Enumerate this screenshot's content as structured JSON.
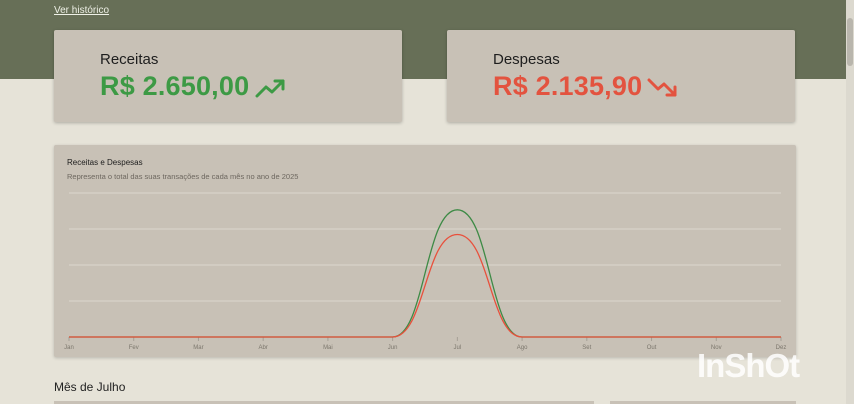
{
  "header": {
    "history_link": "Ver histórico"
  },
  "summary": {
    "income": {
      "label": "Receitas",
      "amount": "R$ 2.650,00",
      "icon": "trending-up-icon",
      "color": "#3d9a45"
    },
    "expenses": {
      "label": "Despesas",
      "amount": "R$ 2.135,90",
      "icon": "trending-down-icon",
      "color": "#e3533f"
    }
  },
  "chart": {
    "title": "Receitas e Despesas",
    "subtitle": "Representa o total das suas transações de cada mês no ano de 2025"
  },
  "chart_data": {
    "type": "line",
    "title": "Receitas e Despesas",
    "subtitle": "Representa o total das suas transações de cada mês no ano de 2025",
    "x": [
      "Jan",
      "Fev",
      "Mar",
      "Abr",
      "Mai",
      "Jun",
      "Jul",
      "Ago",
      "Set",
      "Out",
      "Nov",
      "Dez"
    ],
    "series": [
      {
        "color": "#3d8a45",
        "values": [
          0,
          0,
          0,
          0,
          0,
          0,
          2650,
          0,
          0,
          0,
          0,
          0
        ]
      },
      {
        "color": "#e8503c",
        "values": [
          0,
          0,
          0,
          0,
          0,
          0,
          2135.9,
          0,
          0,
          0,
          0,
          0
        ]
      }
    ],
    "ylim": [
      0,
      3000
    ],
    "grid": true,
    "legend": "none"
  },
  "month_section": {
    "title": "Mês de Julho"
  },
  "watermark": "InShOt"
}
